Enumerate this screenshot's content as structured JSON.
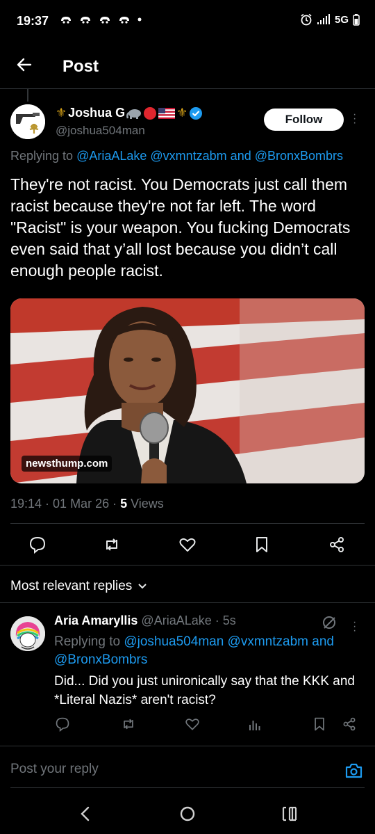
{
  "status_bar": {
    "time": "19:37",
    "network": "5G"
  },
  "header": {
    "title": "Post"
  },
  "post": {
    "author_name": "Joshua G",
    "handle": "@joshua504man",
    "follow_label": "Follow",
    "replying_prefix": "Replying to ",
    "replying_handles": "@AriaALake @vxmntzabm and @BronxBombrs",
    "text": "They're not racist. You Democrats just call them racist because they're not far left. The word \"Racist\" is your weapon. You fucking Democrats even said that y’all lost because you didn’t call enough people racist.",
    "image_caption": "newsthump.com",
    "timestamp": "19:14 · 01 Mar 26 · ",
    "views_count": "5",
    "views_label": " Views"
  },
  "replies_section": {
    "sort_label": "Most relevant replies"
  },
  "reply": {
    "name": "Aria Amaryllis",
    "handle_time": "@AriaALake · 5s",
    "replying_prefix": "Replying to ",
    "replying_handles": "@joshua504man @vxmntzabm and @BronxBombrs",
    "text": "Did... Did you just unironically say that the KKK and *Literal Nazis* aren't racist?"
  },
  "composer": {
    "placeholder": "Post your reply"
  },
  "colors": {
    "accent": "#1d9bf0",
    "background": "#000000",
    "muted": "#71767b"
  },
  "icons": [
    "back-arrow-icon",
    "verified-badge-icon",
    "reply-icon",
    "repost-icon",
    "like-icon",
    "bookmark-icon",
    "share-icon",
    "views-icon",
    "grok-icon",
    "camera-icon",
    "nav-back-icon",
    "nav-home-icon",
    "nav-recents-icon"
  ]
}
